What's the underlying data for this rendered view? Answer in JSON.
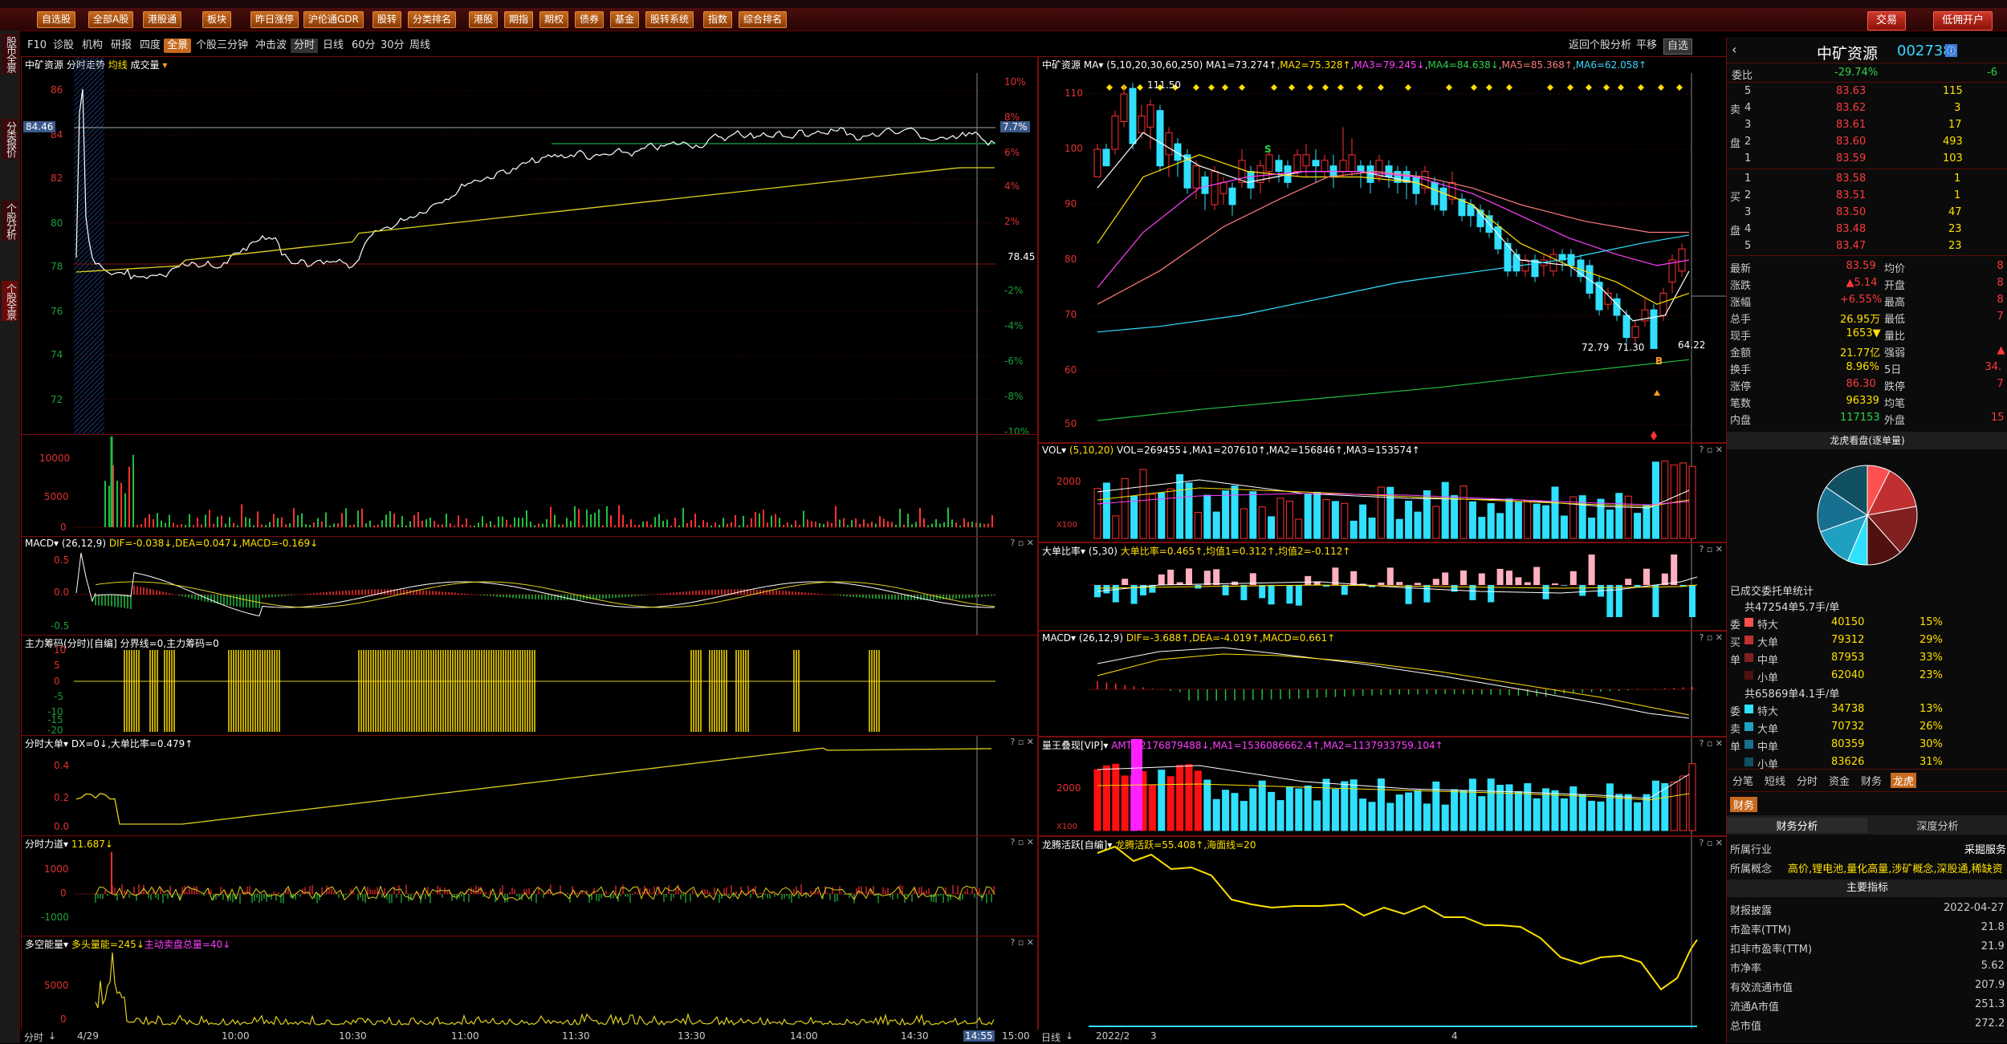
{
  "menu": {
    "left_buttons": [
      "自选股",
      "全部A股",
      "港股通",
      "板块",
      "昨日涨停",
      "沪伦通GDR",
      "股转",
      "分类排名",
      "港股",
      "期指",
      "期权",
      "债券",
      "基金",
      "股转系统",
      "指数",
      "综合排名"
    ],
    "right_buttons": [
      "交易",
      "低佣开户"
    ]
  },
  "left_tabs": [
    "股市全景",
    "分类报价",
    "个股分析",
    "个股全景"
  ],
  "toolbar": {
    "items": [
      "F10",
      "诊股",
      "机构",
      "研报",
      "四度",
      "全景",
      "个股三分钟",
      "冲击波",
      "分时",
      "日线",
      "60分",
      "30分",
      "周线"
    ],
    "selected": "全景",
    "right_items": [
      "返回个股分析",
      "平移",
      "自选"
    ]
  },
  "intraday": {
    "title": "中矿资源",
    "sub": "分时走势",
    "legend1": "均线",
    "legend2": "成交量",
    "price_ticks": [
      "86",
      "84",
      "82",
      "80",
      "78",
      "76",
      "74",
      "72"
    ],
    "pct_ticks": [
      "10%",
      "8%",
      "6%",
      "4%",
      "2%",
      "",
      "-2%",
      "-4%",
      "-6%",
      "-8%",
      "-10%"
    ],
    "prev_close": "78.45",
    "current_price_tag": "84.46",
    "current_pct_tag": "7.7%",
    "vol_ticks": [
      "10000",
      "5000",
      "0"
    ],
    "time_labels": [
      "4/29",
      "10:00",
      "10:30",
      "11:00",
      "11:30",
      "13:30",
      "14:00",
      "14:30",
      "14:55",
      "15:00"
    ],
    "bottom_left": "分时",
    "macd_title": "MACD",
    "macd_params": "(26,12,9)",
    "macd_vals": "DIF=-0.038↓,DEA=0.047↓,MACD=-0.169↓",
    "macd_ticks": [
      "0.5",
      "0.0",
      "-0.5"
    ],
    "zlcm_title": "主力筹码(分时)[自编]",
    "zlcm_vals": "分界线=0,主力筹码=0",
    "zlcm_ticks": [
      "10",
      "5",
      "0",
      "-5",
      "-10",
      "-15",
      "-20"
    ],
    "fsdd_title": "分时大单",
    "fsdd_vals": "DX=0↓,大单比率=0.479↑",
    "fsdd_ticks": [
      "0.4",
      "0.2",
      "0.0"
    ],
    "fsld_title": "分时力道",
    "fsld_vals": "11.687↓",
    "fsld_ticks": [
      "1000",
      "0",
      "-1000"
    ],
    "dknl_title": "多空能量",
    "dknl_vals": "多头量能=245↓",
    "dknl_vals2": "主动卖盘总量=40↓",
    "dknl_ticks": [
      "5000",
      "0"
    ]
  },
  "kline": {
    "title": "中矿资源",
    "ma_label": "MA",
    "ma_params": "(5,10,20,30,60,250)",
    "ma1": "MA1=73.274↑",
    "ma2": "MA2=75.328↑",
    "ma3": "MA3=79.245↓",
    "ma4": "MA4=84.638↓",
    "ma5": "MA5=85.368↑",
    "ma6": "MA6=62.058↑",
    "price_ticks": [
      "110",
      "100",
      "90",
      "80",
      "70",
      "60",
      "50"
    ],
    "high_label": "111.50",
    "low_label": "64.22",
    "mid_label1": "72.79",
    "mid_label2": "71.30",
    "s_mark": "S",
    "b_mark": "B",
    "vol_title": "VOL",
    "vol_params": "(5,10,20)",
    "vol_vals": "VOL=269455↓,MA1=207610↑,MA2=156846↑,MA3=153574↑",
    "vol_tick": "2000",
    "vol_unit": "X100",
    "ddbl_title": "大单比率",
    "ddbl_params": "(5,30)",
    "ddbl_vals": "大单比率=0.465↑,均值1=0.312↑,均值2=-0.112↑",
    "macd_title": "MACD",
    "macd_params": "(26,12,9)",
    "macd_vals": "DIF=-3.688↑,DEA=-4.019↑,MACD=0.661↑",
    "lw_title": "量王叠现[VIP]",
    "lw_vals": "AMT=2176879488↓,MA1=1536086662.4↑,MA2=1137933759.104↑",
    "lw_tick": "2000",
    "lw_unit": "X100",
    "lthy_title": "龙腾活跃[自编]",
    "lthy_vals": "龙腾活跃=55.408↑,海面线=20",
    "date_labels": [
      "2022/2",
      "3",
      "4"
    ],
    "bottom_left": "日线"
  },
  "quote": {
    "name": "中矿资源",
    "code": "002738",
    "weibi_label": "委比",
    "weibi_pct": "-29.74%",
    "weibi_val": "-6",
    "sell": [
      {
        "label": "5",
        "price": "83.63",
        "vol": "115"
      },
      {
        "label": "4",
        "price": "83.62",
        "vol": "3"
      },
      {
        "label": "3",
        "price": "83.61",
        "vol": "17"
      },
      {
        "label": "2",
        "price": "83.60",
        "vol": "493"
      },
      {
        "label": "1",
        "price": "83.59",
        "vol": "103"
      }
    ],
    "buy": [
      {
        "label": "1",
        "price": "83.58",
        "vol": "1"
      },
      {
        "label": "2",
        "price": "83.51",
        "vol": "1"
      },
      {
        "label": "3",
        "price": "83.50",
        "vol": "47"
      },
      {
        "label": "4",
        "price": "83.48",
        "vol": "23"
      },
      {
        "label": "5",
        "price": "83.47",
        "vol": "23"
      }
    ],
    "sell_side_chars": [
      "卖",
      "盘"
    ],
    "buy_side_chars": [
      "买",
      "盘"
    ],
    "stats": [
      {
        "k1": "最新",
        "v1": "83.59",
        "k2": "均价",
        "v2": "8"
      },
      {
        "k1": "涨跌",
        "v1": "▲5.14",
        "k2": "开盘",
        "v2": "8"
      },
      {
        "k1": "涨幅",
        "v1": "+6.55%",
        "k2": "最高",
        "v2": "8"
      },
      {
        "k1": "总手",
        "v1": "26.95万",
        "k2": "最低",
        "v2": "7"
      },
      {
        "k1": "现手",
        "v1": "1653▼",
        "k2": "量比",
        "v2": ""
      },
      {
        "k1": "金额",
        "v1": "21.77亿",
        "k2": "强弱",
        "v2": "▲"
      },
      {
        "k1": "换手",
        "v1": "8.96%",
        "k2": "5日",
        "v2": "34."
      },
      {
        "k1": "涨停",
        "v1": "86.30",
        "k2": "跌停",
        "v2": "7"
      },
      {
        "k1": "笔数",
        "v1": "96339",
        "k2": "均笔",
        "v2": ""
      },
      {
        "k1": "内盘",
        "v1": "117153",
        "k2": "外盘",
        "v2": "15"
      }
    ],
    "pie_title": "龙虎看盘(逐单量)",
    "order_stats_title": "已成交委托单统计",
    "buy_total": "共47254单5.7手/单",
    "sell_total": "共65869单4.1手/单",
    "buy_label": [
      "委",
      "买",
      "单"
    ],
    "sell_label": [
      "委",
      "卖",
      "单"
    ],
    "buy_rows": [
      {
        "k": "特大",
        "v": "40150",
        "p": "15%",
        "c": "#ff5050"
      },
      {
        "k": "大单",
        "v": "79312",
        "p": "29%",
        "c": "#c03030"
      },
      {
        "k": "中单",
        "v": "87953",
        "p": "33%",
        "c": "#802020"
      },
      {
        "k": "小单",
        "v": "62040",
        "p": "23%",
        "c": "#501010"
      }
    ],
    "sell_rows": [
      {
        "k": "特大",
        "v": "34738",
        "p": "13%",
        "c": "#30e0ff"
      },
      {
        "k": "大单",
        "v": "70732",
        "p": "26%",
        "c": "#20a0c0"
      },
      {
        "k": "中单",
        "v": "80359",
        "p": "30%",
        "c": "#187090"
      },
      {
        "k": "小单",
        "v": "83626",
        "p": "31%",
        "c": "#105060"
      }
    ],
    "bottom_tabs": [
      "分笔",
      "短线",
      "分时",
      "资金",
      "财务",
      "龙虎"
    ],
    "bottom_tab_selected": "龙虎",
    "fin_tab": "财务",
    "fin_subtabs": [
      "财务分析",
      "深度分析"
    ],
    "industry_label": "所属行业",
    "industry_val": "采掘服务",
    "concept_label": "所属概念",
    "concept_val": "高价,锂电池,量化高量,涉矿概念,深股通,稀缺资",
    "main_index": "主要指标",
    "fin_rows": [
      {
        "k": "财报披露",
        "v": "2022-04-27"
      },
      {
        "k": "市盈率(TTM)",
        "v": "21.8"
      },
      {
        "k": "扣非市盈率(TTM)",
        "v": "21.9"
      },
      {
        "k": "市净率",
        "v": "5.62"
      },
      {
        "k": "有效流通市值",
        "v": "207.9"
      },
      {
        "k": "流通A市值",
        "v": "251.3"
      },
      {
        "k": "总市值",
        "v": "272.2"
      }
    ]
  }
}
